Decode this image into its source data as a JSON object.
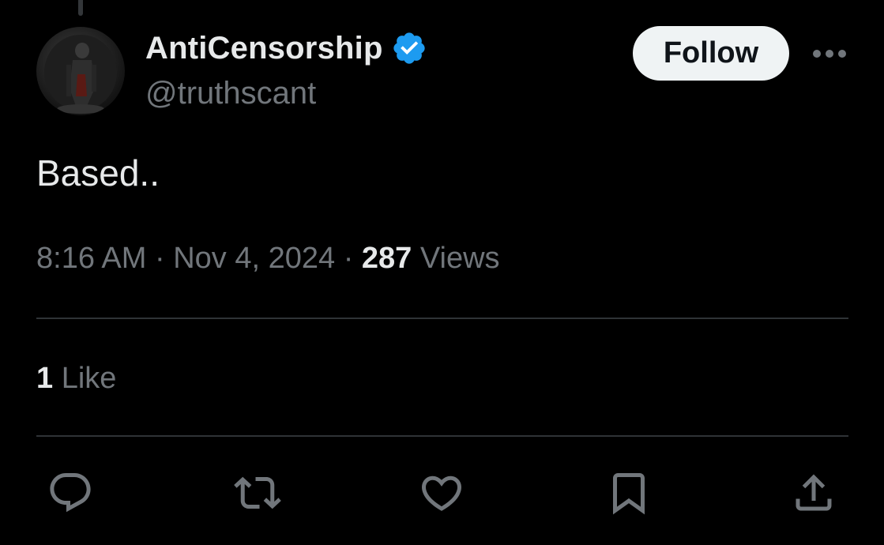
{
  "author": {
    "display_name": "AntiCensorship",
    "handle": "@truthscant",
    "verified": true,
    "verified_color": "#1d9bf0"
  },
  "follow_label": "Follow",
  "more_icon": "more-horizontal-icon",
  "post": {
    "text": "Based.."
  },
  "meta": {
    "time": "8:16 AM",
    "separator": "·",
    "date": "Nov 4, 2024",
    "views_count": "287",
    "views_label": "Views"
  },
  "engagement": {
    "likes_count": "1",
    "likes_label": "Like"
  },
  "actions": [
    {
      "name": "reply",
      "icon": "reply-icon"
    },
    {
      "name": "repost",
      "icon": "repost-icon"
    },
    {
      "name": "like",
      "icon": "heart-icon"
    },
    {
      "name": "bookmark",
      "icon": "bookmark-icon"
    },
    {
      "name": "share",
      "icon": "share-icon"
    }
  ],
  "colors": {
    "background": "#000000",
    "primary_text": "#e7e9ea",
    "secondary_text": "#71767b",
    "divider": "#2f3336",
    "follow_bg": "#eff3f4"
  }
}
